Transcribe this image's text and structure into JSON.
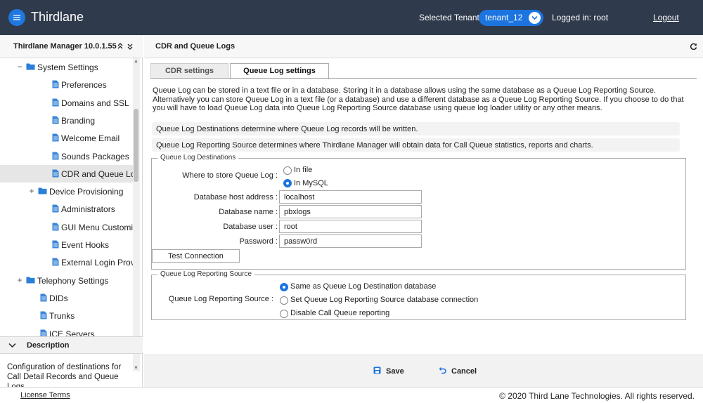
{
  "header": {
    "app_title": "Thirdlane",
    "tenant_label": "Selected Tenant :",
    "tenant_value": "tenant_12",
    "logged_in": "Logged in: root",
    "logout": "Logout"
  },
  "sidebar": {
    "title": "Thirdlane Manager 10.0.1.55",
    "items": [
      {
        "label": "System Settings",
        "type": "folder",
        "toggle": "−"
      },
      {
        "label": "Preferences",
        "type": "doc"
      },
      {
        "label": "Domains and SSL",
        "type": "doc"
      },
      {
        "label": "Branding",
        "type": "doc"
      },
      {
        "label": "Welcome Email",
        "type": "doc"
      },
      {
        "label": "Sounds Packages",
        "type": "doc"
      },
      {
        "label": "CDR and Queue Logs",
        "type": "doc",
        "selected": true
      },
      {
        "label": "Device Provisioning",
        "type": "folder",
        "toggle": "+"
      },
      {
        "label": "Administrators",
        "type": "doc"
      },
      {
        "label": "GUI Menu Customiz...",
        "type": "doc"
      },
      {
        "label": "Event Hooks",
        "type": "doc"
      },
      {
        "label": "External Login Provi...",
        "type": "doc"
      },
      {
        "label": "Telephony Settings",
        "type": "folder",
        "toggle": "+"
      },
      {
        "label": "DIDs",
        "type": "doc"
      },
      {
        "label": "Trunks",
        "type": "doc"
      },
      {
        "label": "ICE Servers",
        "type": "doc"
      }
    ],
    "description_title": "Description",
    "description_text": "Configuration of destinations for Call Detail Records and Queue Logs."
  },
  "footer": {
    "license": "License Terms",
    "copyright": "© 2020 Third Lane Technologies. All rights reserved."
  },
  "main": {
    "title": "CDR and Queue Logs",
    "tabs": [
      {
        "label": "CDR settings",
        "active": false
      },
      {
        "label": "Queue Log settings",
        "active": true
      }
    ],
    "intro": "Queue Log can be stored in a text file or in a database. Storing it in a database allows using the same database as a Queue Log Reporting Source. Alternatively you can store Queue Log in a text file (or a database) and use a different database as a Queue Log Reporting Source. If you choose to do that you will have to load Queue Log data into Queue Log Reporting Source database using queue log loader utility or any other means.",
    "info1": "Queue Log Destinations determine where Queue Log records will be written.",
    "info2": "Queue Log Reporting Source determines where Thirdlane Manager will obtain data for Call Queue statistics, reports and charts.",
    "destinations": {
      "legend": "Queue Log Destinations",
      "store_label": "Where to store Queue Log :",
      "options": [
        {
          "label": "In file",
          "selected": false
        },
        {
          "label": "In MySQL",
          "selected": true
        }
      ],
      "db_host_label": "Database host address :",
      "db_host": "localhost",
      "db_name_label": "Database name :",
      "db_name": "pbxlogs",
      "db_user_label": "Database user :",
      "db_user": "root",
      "password_label": "Password :",
      "password": "passw0rd",
      "test_button": "Test Connection"
    },
    "reporting": {
      "legend": "Queue Log Reporting Source",
      "label": "Queue Log Reporting Source :",
      "options": [
        {
          "label": "Same as Queue Log Destination database",
          "selected": true
        },
        {
          "label": "Set Queue Log Reporting Source database connection",
          "selected": false
        },
        {
          "label": "Disable Call Queue reporting",
          "selected": false
        }
      ]
    },
    "save": "Save",
    "cancel": "Cancel"
  },
  "colors": {
    "header_bg": "#2f3a4c",
    "accent": "#1c74e0",
    "folder": "#2a7fd8",
    "doc": "#3a86d8"
  }
}
